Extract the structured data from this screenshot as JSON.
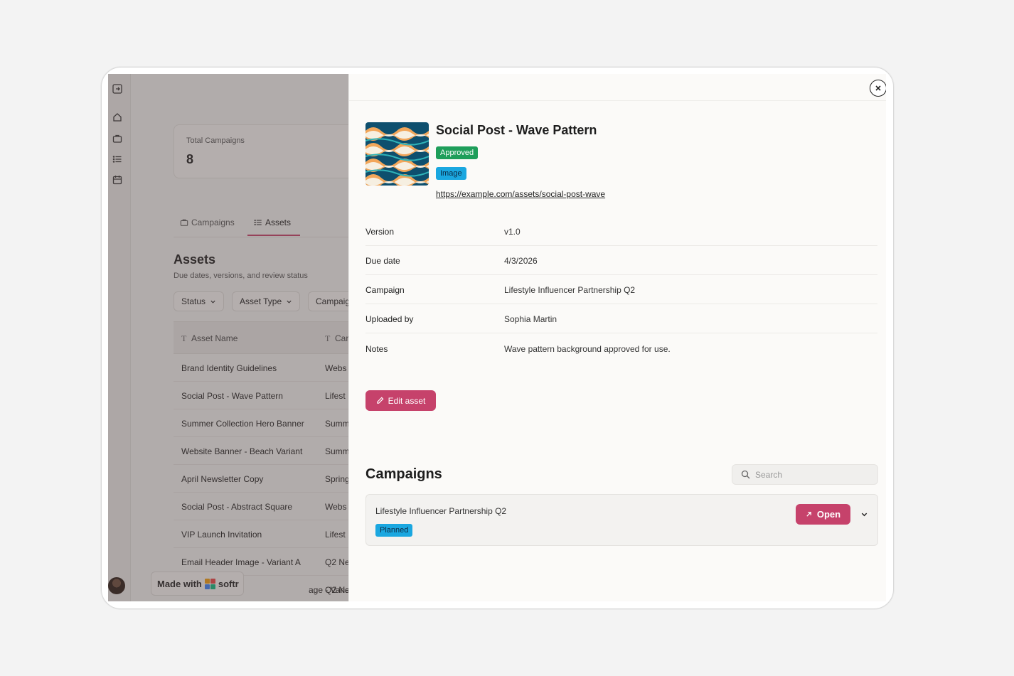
{
  "sidebar": {
    "icons": [
      "sidebar-toggle-icon",
      "home-icon",
      "briefcase-icon",
      "list-icon",
      "calendar-icon"
    ]
  },
  "stats": {
    "label": "Total Campaigns",
    "value": "8"
  },
  "tabs": [
    {
      "label": "Campaigns",
      "icon": "briefcase-icon"
    },
    {
      "label": "Assets",
      "icon": "list-icon",
      "active": true
    }
  ],
  "assets_section": {
    "title": "Assets",
    "subtitle": "Due dates, versions, and review status",
    "filters": [
      "Status",
      "Asset Type",
      "Campaig"
    ]
  },
  "table": {
    "columns": [
      "Asset Name",
      "Car"
    ],
    "rows": [
      {
        "name": "Brand Identity Guidelines",
        "campaign": "Webs"
      },
      {
        "name": "Social Post - Wave Pattern",
        "campaign": "Lifest"
      },
      {
        "name": "Summer Collection Hero Banner",
        "campaign": "Summ"
      },
      {
        "name": "Website Banner - Beach Variant",
        "campaign": "Summ"
      },
      {
        "name": "April Newsletter Copy",
        "campaign": "Spring"
      },
      {
        "name": "Social Post - Abstract Square",
        "campaign": "Webs"
      },
      {
        "name": "VIP Launch Invitation",
        "campaign": "Lifest"
      },
      {
        "name": "Email Header Image - Variant A",
        "campaign": "Q2 Ne"
      },
      {
        "name": "age - Variant B",
        "campaign": "Q2 Ne"
      }
    ]
  },
  "made_with": {
    "prefix": "Made with",
    "brand": "softr"
  },
  "detail": {
    "title": "Social Post - Wave Pattern",
    "status_badge": "Approved",
    "type_badge": "Image",
    "link": "https://example.com/assets/social-post-wave",
    "fields": [
      {
        "label": "Version",
        "value": "v1.0"
      },
      {
        "label": "Due date",
        "value": "4/3/2026"
      },
      {
        "label": "Campaign",
        "value": "Lifestyle Influencer Partnership Q2"
      },
      {
        "label": "Uploaded by",
        "value": "Sophia Martin"
      },
      {
        "label": "Notes",
        "value": "Wave pattern background approved for use."
      }
    ],
    "edit_label": "Edit asset"
  },
  "campaigns": {
    "title": "Campaigns",
    "search_placeholder": "Search",
    "items": [
      {
        "name": "Lifestyle Influencer Partnership Q2",
        "status": "Planned",
        "open_label": "Open"
      }
    ]
  },
  "colors": {
    "accent": "#c6426b",
    "approved": "#1e9e5a",
    "info": "#1aa7e0"
  }
}
